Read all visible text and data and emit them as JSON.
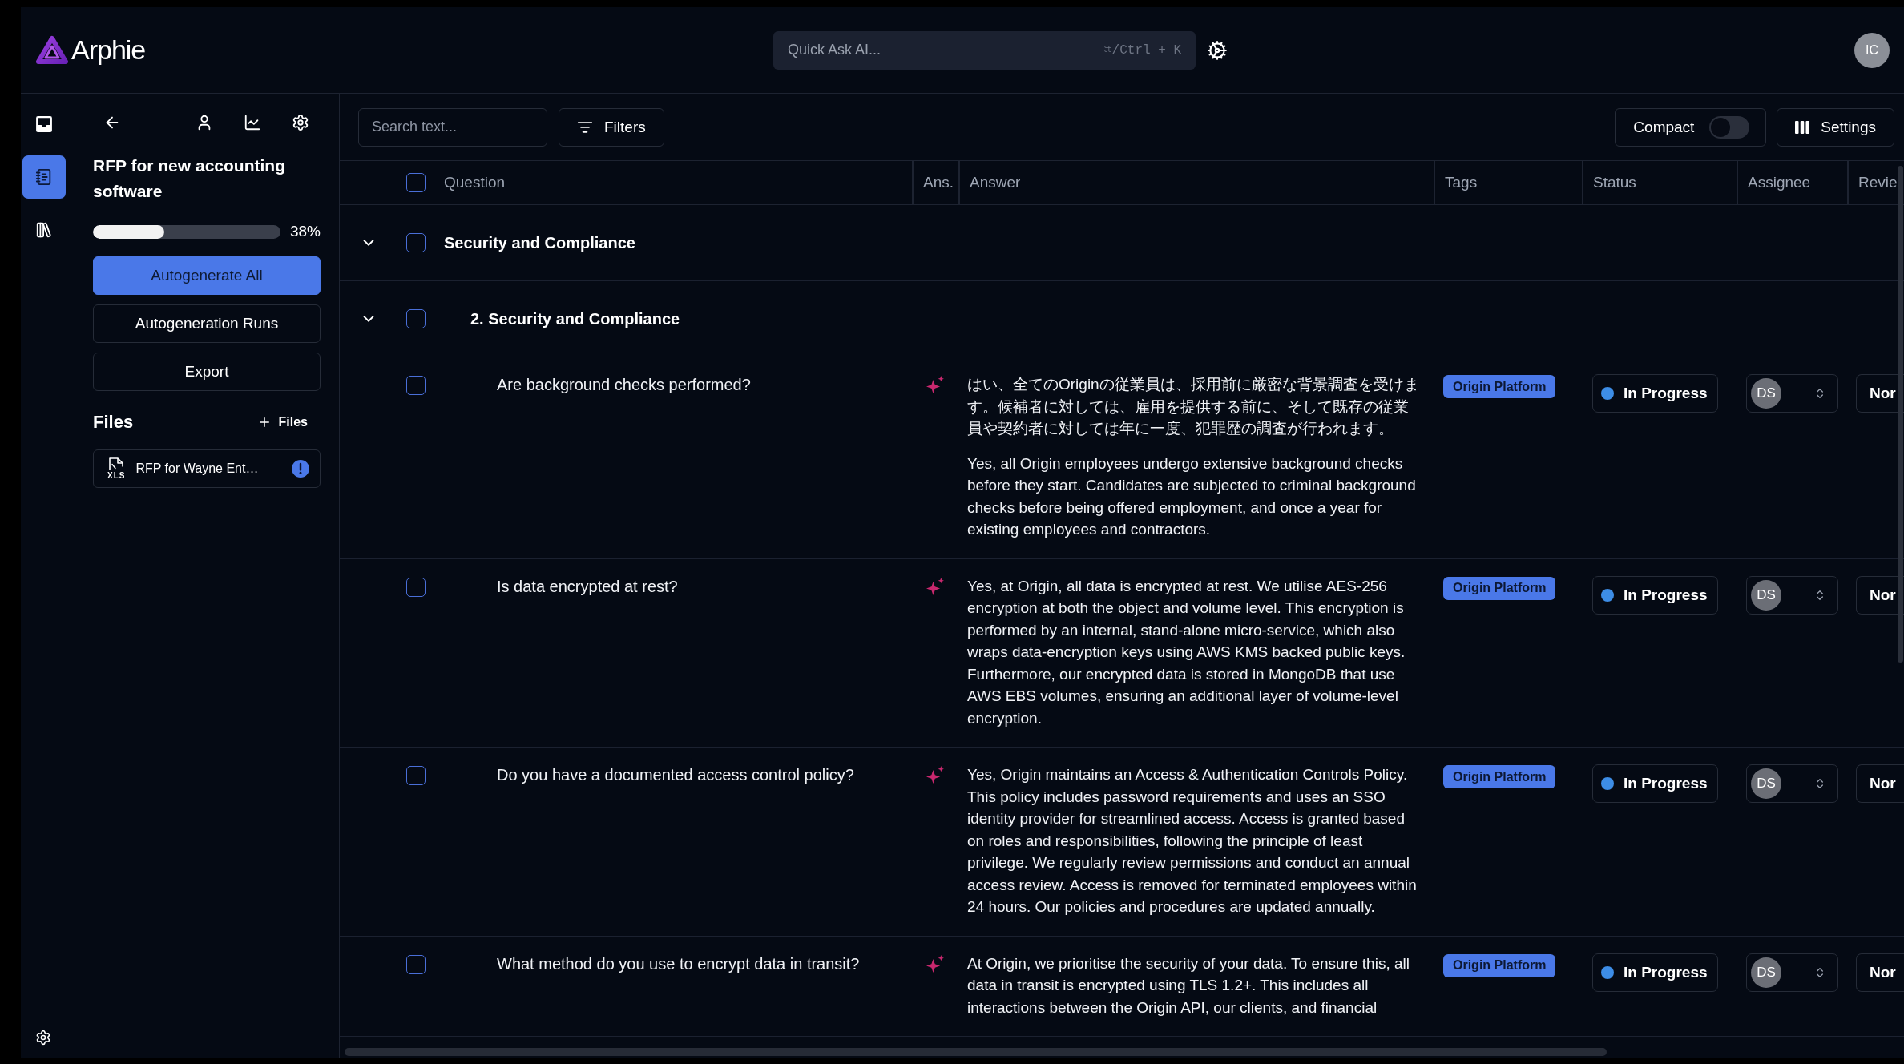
{
  "topbar": {
    "logo": "Arphie",
    "quick_ask": {
      "placeholder": "Quick Ask AI...",
      "shortcut": "⌘/Ctrl + K"
    },
    "avatar": "IC"
  },
  "rail": [
    {
      "selected": false
    },
    {
      "selected": true
    },
    {
      "selected": false
    }
  ],
  "sidebar": {
    "title": "RFP for new accounting software",
    "progress": {
      "level": 0.38,
      "reading": "38%"
    },
    "buttons": [
      {
        "label": "Autogenerate All",
        "kind": "primary"
      },
      {
        "label": "Autogeneration Runs",
        "kind": "outline"
      },
      {
        "label": "Export",
        "kind": "outline"
      }
    ],
    "files": {
      "heading": "Files",
      "add_label": "Files",
      "items": [
        {
          "name": "RFP for Wayne Ent…",
          "type": "XLS",
          "warning": true
        }
      ]
    }
  },
  "toolbar": {
    "search": {
      "placeholder": "Search text..."
    },
    "filters": "Filters",
    "compact": {
      "label": "Compact",
      "on": false
    },
    "settings": "Settings"
  },
  "table": {
    "select_all": {
      "checked": false
    },
    "columns": [
      "Question",
      "Ans.",
      "Answer",
      "Tags",
      "Status",
      "Assignee",
      "Revie"
    ],
    "rows": [
      {
        "kind": "section",
        "title": "Security and Compliance",
        "expanded": true,
        "checked": false,
        "children": [
          {
            "kind": "section",
            "title": "2. Security and Compliance",
            "expanded": true,
            "checked": false,
            "children": [
              {
                "kind": "question",
                "checked": false,
                "question": "Are background checks performed?",
                "ai_generated": true,
                "answer": [
                  "はい、全てのOriginの従業員は、採用前に厳密な背景調査を受けます。候補者に対しては、雇用を提供する前に、そして既存の従業員や契約者に対しては年に一度、犯罪歴の調査が行われます。",
                  "Yes, all Origin employees undergo extensive background checks before they start. Candidates are subjected to criminal background checks before being offered employment, and once a year for existing employees and contractors."
                ],
                "tags": [
                  "Origin Platform"
                ],
                "status": {
                  "label": "In Progress",
                  "color": "#3d8de6"
                },
                "assignee": "DS",
                "review": "Nor"
              },
              {
                "kind": "question",
                "checked": false,
                "question": "Is data encrypted at rest?",
                "ai_generated": true,
                "answer": [
                  "Yes, at Origin, all data is encrypted at rest. We utilise AES-256 encryption at both the object and volume level. This encryption is performed by an internal, stand-alone micro-service, which also wraps data-encryption keys using AWS KMS backed public keys. Furthermore, our encrypted data is stored in MongoDB that use AWS EBS volumes, ensuring an additional layer of volume-level encryption."
                ],
                "tags": [
                  "Origin Platform"
                ],
                "status": {
                  "label": "In Progress",
                  "color": "#3d8de6"
                },
                "assignee": "DS",
                "review": "Nor"
              },
              {
                "kind": "question",
                "checked": false,
                "question": "Do you have a documented access control policy?",
                "ai_generated": true,
                "answer": [
                  "Yes, Origin maintains an Access & Authentication Controls Policy. This policy includes password requirements and uses an SSO identity provider for streamlined access. Access is granted based on roles and responsibilities, following the principle of least privilege. We regularly review permissions and conduct an annual access review. Access is removed for terminated employees within 24 hours. Our policies and procedures are updated annually."
                ],
                "tags": [
                  "Origin Platform"
                ],
                "status": {
                  "label": "In Progress",
                  "color": "#3d8de6"
                },
                "assignee": "DS",
                "review": "Nor"
              },
              {
                "kind": "question",
                "checked": false,
                "question": "What method do you use to encrypt data in transit?",
                "ai_generated": true,
                "answer": [
                  "At Origin, we prioritise the security of your data. To ensure this, all data in transit is encrypted using TLS 1.2+. This includes all interactions between the Origin API, our clients, and financial"
                ],
                "tags": [
                  "Origin Platform"
                ],
                "status": {
                  "label": "In Progress",
                  "color": "#3d8de6"
                },
                "assignee": "DS",
                "review": "Nor"
              }
            ]
          }
        ]
      }
    ]
  }
}
